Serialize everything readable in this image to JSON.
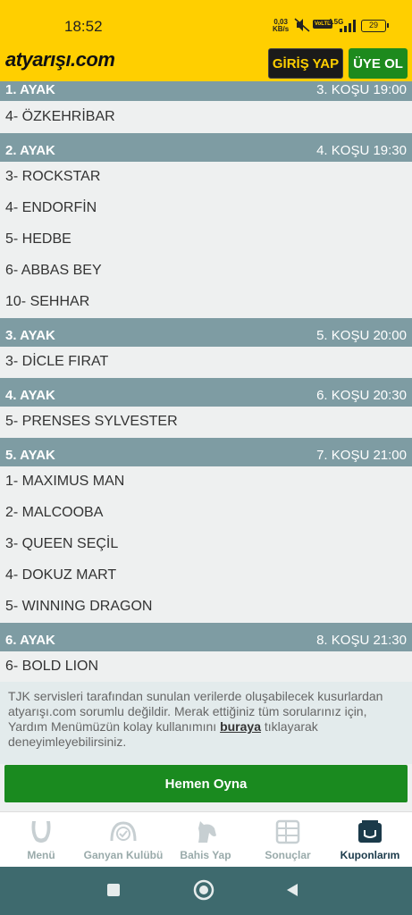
{
  "status_bar": {
    "time": "18:52",
    "net_speed_value": "0,03",
    "net_speed_unit": "KB/s",
    "volte": "VoLTE",
    "network": "4.5G",
    "battery": "29"
  },
  "header": {
    "logo": "atyarışı.com",
    "login_label": "GİRİŞ YAP",
    "signup_label": "ÜYE OL"
  },
  "legs": [
    {
      "name": "1. AYAK",
      "race": "3. KOŞU 19:00",
      "horses": [
        "4- ÖZKEHRİBAR"
      ]
    },
    {
      "name": "2. AYAK",
      "race": "4. KOŞU 19:30",
      "horses": [
        "3- ROCKSTAR",
        "4- ENDORFİN",
        "5- HEDBE",
        "6- ABBAS BEY",
        "10- SEHHAR"
      ]
    },
    {
      "name": "3. AYAK",
      "race": "5. KOŞU 20:00",
      "horses": [
        "3- DİCLE FIRAT"
      ]
    },
    {
      "name": "4. AYAK",
      "race": "6. KOŞU 20:30",
      "horses": [
        "5- PRENSES SYLVESTER"
      ]
    },
    {
      "name": "5. AYAK",
      "race": "7. KOŞU 21:00",
      "horses": [
        "1- MAXIMUS MAN",
        "2- MALCOOBA",
        "3- QUEEN SEÇİL",
        "4- DOKUZ MART",
        "5- WINNING DRAGON"
      ]
    },
    {
      "name": "6. AYAK",
      "race": "8. KOŞU 21:30",
      "horses": [
        "6- BOLD LION"
      ]
    }
  ],
  "disclaimer": {
    "text_before": "TJK servisleri tarafından sunulan verilerde oluşabilecek kusurlardan atyarışı.com sorumlu değildir. Merak ettiğiniz tüm sorularınız için, Yardım Menümüzün kolay kullanımını ",
    "link": "buraya",
    "text_after": " tıklayarak deneyimleyebilirsiniz."
  },
  "play_button": "Hemen Oyna",
  "tabs": [
    {
      "label": "Menü",
      "icon": "horseshoe-menu-icon"
    },
    {
      "label": "Ganyan Kulübü",
      "icon": "club-icon"
    },
    {
      "label": "Bahis Yap",
      "icon": "horse-head-icon"
    },
    {
      "label": "Sonuçlar",
      "icon": "results-grid-icon"
    },
    {
      "label": "Kuponlarım",
      "icon": "coupon-icon",
      "active": true
    }
  ],
  "colors": {
    "brand_yellow": "#ffcf00",
    "leg_header": "#7e9ca3",
    "green": "#1a8a1f",
    "nav": "#3e6a6e"
  }
}
